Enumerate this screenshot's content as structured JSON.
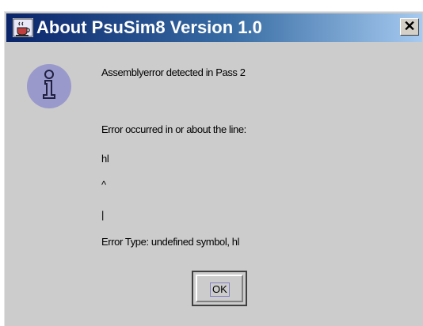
{
  "window": {
    "title": "About PsuSim8 Version 1.0",
    "close_label": "✕"
  },
  "message": {
    "line1": "Assemblyerror detected in Pass 2",
    "line2": "Error occurred in or about the line:",
    "line3": "hl",
    "line4": "^",
    "line5": "|",
    "line6": "Error Type: undefined symbol, hl"
  },
  "buttons": {
    "ok_label": "OK"
  },
  "icons": {
    "app": "java-cup-icon",
    "info": "info-icon"
  },
  "colors": {
    "dialog_bg": "#cccccc",
    "title_start": "#0a246a",
    "title_end": "#a6caf0",
    "info_circle": "#9999cc"
  }
}
